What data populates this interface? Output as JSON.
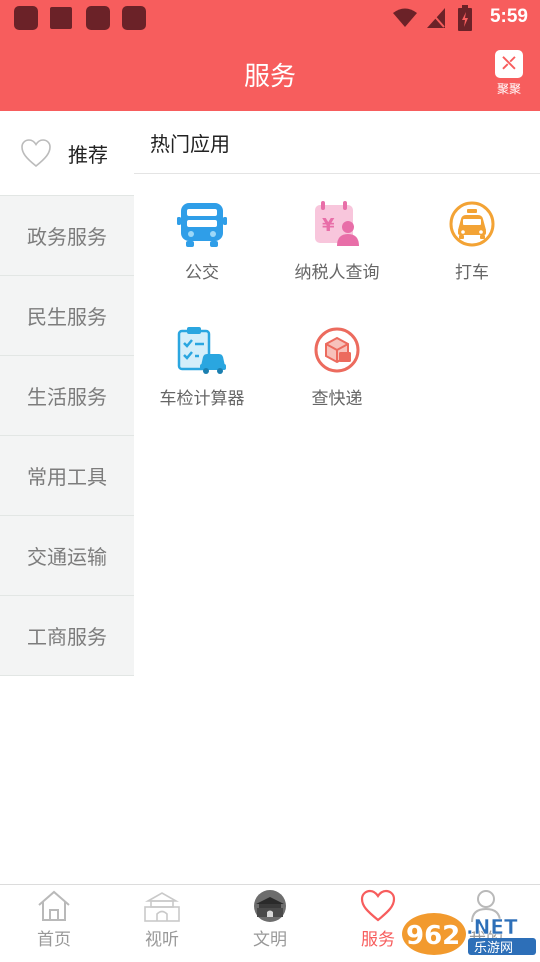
{
  "status_bar": {
    "time": "5:59"
  },
  "header": {
    "title": "服务",
    "right_button_label": "聚聚"
  },
  "sidebar": {
    "items": [
      {
        "label": "推荐",
        "active": true,
        "icon": "heart-outline-icon"
      },
      {
        "label": "政务服务"
      },
      {
        "label": "民生服务"
      },
      {
        "label": "生活服务"
      },
      {
        "label": "常用工具"
      },
      {
        "label": "交通运输"
      },
      {
        "label": "工商服务"
      }
    ]
  },
  "main": {
    "section_title": "热门应用",
    "apps": [
      {
        "label": "公交",
        "icon": "bus-icon",
        "color": "#2f9ee8"
      },
      {
        "label": "纳税人查询",
        "icon": "tax-calendar-icon",
        "color": "#e86ea8"
      },
      {
        "label": "打车",
        "icon": "taxi-icon",
        "color": "#f3a335"
      },
      {
        "label": "车检计算器",
        "icon": "car-inspection-icon",
        "color": "#2aa6e0"
      },
      {
        "label": "查快递",
        "icon": "package-icon",
        "color": "#ec6b5e"
      }
    ]
  },
  "bottom_nav": {
    "items": [
      {
        "label": "首页",
        "icon": "home-icon"
      },
      {
        "label": "视听",
        "icon": "gate-tower-icon"
      },
      {
        "label": "文明",
        "icon": "landmark-avatar-icon"
      },
      {
        "label": "服务",
        "icon": "heart-icon",
        "active": true
      },
      {
        "label": "我的",
        "icon": "person-icon"
      }
    ]
  },
  "watermark": {
    "text_962": "962",
    "text_net": ".NET",
    "text_site": "乐游网"
  },
  "colors": {
    "accent": "#f75d5d",
    "sidebar_bg": "#f3f4f4",
    "inactive_text": "#999999"
  }
}
